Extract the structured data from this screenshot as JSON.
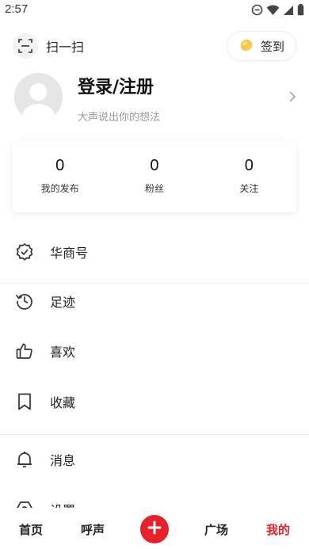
{
  "status_bar": {
    "time": "2:57",
    "icons": [
      "do-not-disturb-icon",
      "wifi-icon",
      "cellular-signal-icon",
      "battery-icon"
    ]
  },
  "header": {
    "scan_label": "扫一扫",
    "signin_label": "签到"
  },
  "profile": {
    "title": "登录/注册",
    "subtitle": "大声说出你的想法"
  },
  "stats": [
    {
      "value": "0",
      "label": "我的发布"
    },
    {
      "value": "0",
      "label": "粉丝"
    },
    {
      "value": "0",
      "label": "关注"
    }
  ],
  "menu": [
    {
      "label": "华商号",
      "icon": "verified-badge-icon"
    },
    {
      "label": "足迹",
      "icon": "history-icon"
    },
    {
      "label": "喜欢",
      "icon": "thumbs-up-icon"
    },
    {
      "label": "收藏",
      "icon": "bookmark-icon"
    },
    {
      "label": "消息",
      "icon": "bell-icon"
    },
    {
      "label": "设置",
      "icon": "settings-icon"
    }
  ],
  "bottom_nav": {
    "items": [
      "首页",
      "呼声",
      "广场",
      "我的"
    ],
    "active": "我的",
    "active_color": "#e8202a"
  },
  "colors": {
    "accent": "#e8202a",
    "text": "#222222",
    "muted": "#999999"
  }
}
